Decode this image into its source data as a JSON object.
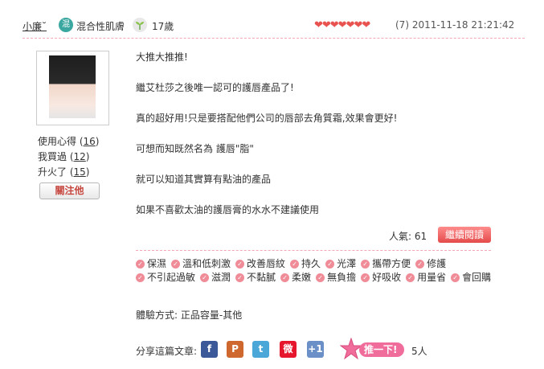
{
  "header": {
    "username": "小廉˘",
    "skin_badge": "混",
    "skin_type": "混合性肌膚",
    "age": "17歲",
    "hearts": "❤❤❤❤❤❤❤",
    "rating_meta": "(7) 2011-11-18 21:21:42"
  },
  "profile": {
    "stats": [
      {
        "label": "使用心得",
        "count": "16"
      },
      {
        "label": "我買過",
        "count": "12"
      },
      {
        "label": "升火了",
        "count": "15"
      }
    ],
    "follow_label": "關注他"
  },
  "content": {
    "paragraphs": [
      "大推大推推!",
      "繼艾杜莎之後唯一認可的護唇產品了!",
      "真的超好用!只是要搭配他們公司的唇部去角質霜,效果會更好!",
      "可想而知既然名為 護唇\"脂\"",
      "就可以知道其實算有點油的產品",
      "如果不喜歡太油的護唇膏的水水不建議使用"
    ]
  },
  "popularity": {
    "label": "人氣: 61",
    "readmore_label": "繼續閱讀"
  },
  "tags": [
    "保濕",
    "溫和低刺激",
    "改善唇紋",
    "持久",
    "光澤",
    "攜帶方便",
    "修護",
    "不引起過敏",
    "滋潤",
    "不黏膩",
    "柔嫩",
    "無負擔",
    "好吸收",
    "用量省",
    "會回購"
  ],
  "trial": "體驗方式: 正品容量-其他",
  "share": {
    "label": "分享這篇文章:",
    "icons": [
      {
        "name": "facebook",
        "glyph": "f",
        "color": "#3b5998"
      },
      {
        "name": "plurk",
        "glyph": "P",
        "color": "#cf682f"
      },
      {
        "name": "twitter",
        "glyph": "t",
        "color": "#4aa7d8"
      },
      {
        "name": "weibo",
        "glyph": "微",
        "color": "#e6162d"
      },
      {
        "name": "google-plus-one",
        "glyph": "+1",
        "color": "#6b8fc7"
      }
    ],
    "push_label": "推一下!",
    "push_count": "5人"
  }
}
